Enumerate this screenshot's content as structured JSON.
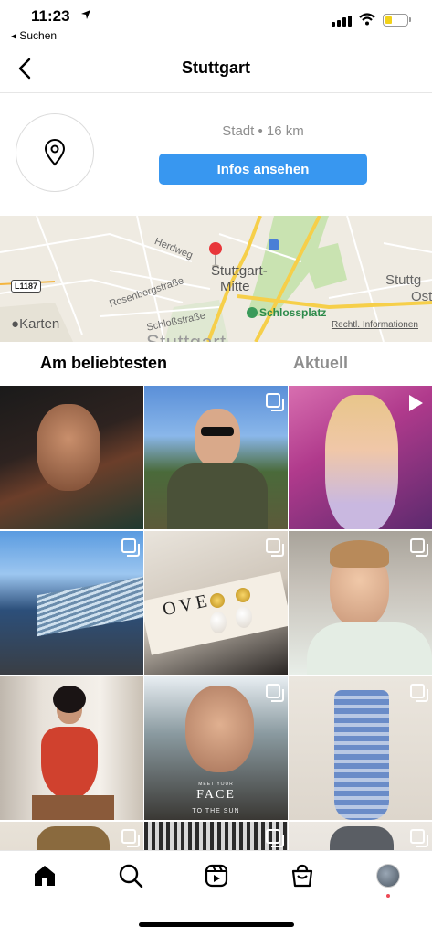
{
  "status_bar": {
    "time": "11:23",
    "back_app": "◂ Suchen"
  },
  "header": {
    "title": "Stuttgart",
    "back_icon": "chevron-left-icon"
  },
  "location": {
    "icon": "location-pin-icon",
    "subtitle": "Stadt • 16 km",
    "info_button": "Infos ansehen"
  },
  "map": {
    "labels": {
      "herdweg": "Herdweg",
      "rosenberg": "Rosenbergstraße",
      "schloss": "Schloßstraße",
      "road": "L1187",
      "mitte_1": "Stuttgart-",
      "mitte_2": "Mitte",
      "ost_1": "Stuttg",
      "ost_2": "Ost",
      "schlossplatz": "Schlossplatz",
      "city": "Stuttgart",
      "provider": "Karten",
      "legal": "Rechtl. Informationen"
    },
    "pin_color": "#e8363a"
  },
  "tabs": [
    {
      "label": "Am beliebtesten",
      "active": true
    },
    {
      "label": "Aktuell",
      "active": false
    }
  ],
  "grid": {
    "tiles": [
      {
        "subject": "woman-portrait-dark",
        "badge": "none"
      },
      {
        "subject": "man-sunglasses-outdoor",
        "badge": "multi"
      },
      {
        "subject": "woman-pink-room",
        "badge": "video"
      },
      {
        "subject": "blue-building-sky",
        "badge": "multi"
      },
      {
        "subject": "pearl-earrings",
        "badge": "multi"
      },
      {
        "subject": "woman-selfie-white",
        "badge": "multi"
      },
      {
        "subject": "woman-red-dress",
        "badge": "none"
      },
      {
        "subject": "woman-sun-face",
        "badge": "multi"
      },
      {
        "subject": "blue-striped-dress",
        "badge": "multi"
      },
      {
        "subject": "brown-sweater",
        "badge": "multi"
      },
      {
        "subject": "striped-shirt",
        "badge": "multi"
      },
      {
        "subject": "grey-sweater",
        "badge": "multi"
      }
    ],
    "overlay_text": {
      "small": "MEET YOUR",
      "big": "FACE",
      "sub": "TO THE SUN"
    },
    "earring_text": "OVE"
  },
  "bottom_nav": [
    {
      "icon": "home-icon",
      "active": true
    },
    {
      "icon": "search-icon",
      "active": false
    },
    {
      "icon": "reels-icon",
      "active": false
    },
    {
      "icon": "shop-icon",
      "active": false
    },
    {
      "icon": "profile-avatar",
      "active": false
    }
  ],
  "colors": {
    "accent": "#3897f0",
    "notification": "#ed4956"
  }
}
